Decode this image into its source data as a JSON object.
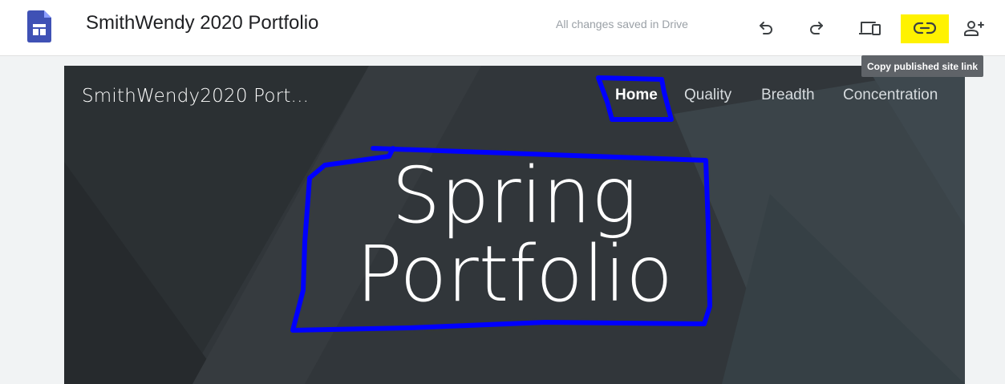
{
  "app": {
    "title": "SmithWendy 2020 Portfolio",
    "save_status": "All changes saved in Drive",
    "logo_icon": "google-sites-icon",
    "accent_color": "#3f51b5"
  },
  "toolbar": {
    "undo_icon": "undo-icon",
    "redo_icon": "redo-icon",
    "preview_icon": "devices-preview-icon",
    "link_icon": "link-icon",
    "share_icon": "add-person-icon",
    "highlight_color": "#fff200",
    "tooltip": "Copy published site link"
  },
  "site": {
    "title": "SmithWendy2020 Port...",
    "nav": [
      {
        "label": "Home",
        "active": true
      },
      {
        "label": "Quality",
        "active": false
      },
      {
        "label": "Breadth",
        "active": false
      },
      {
        "label": "Concentration",
        "active": false
      }
    ],
    "hero": {
      "line1": "Spring",
      "line2": "Portfolio"
    },
    "annotation_color": "#0000ff"
  }
}
